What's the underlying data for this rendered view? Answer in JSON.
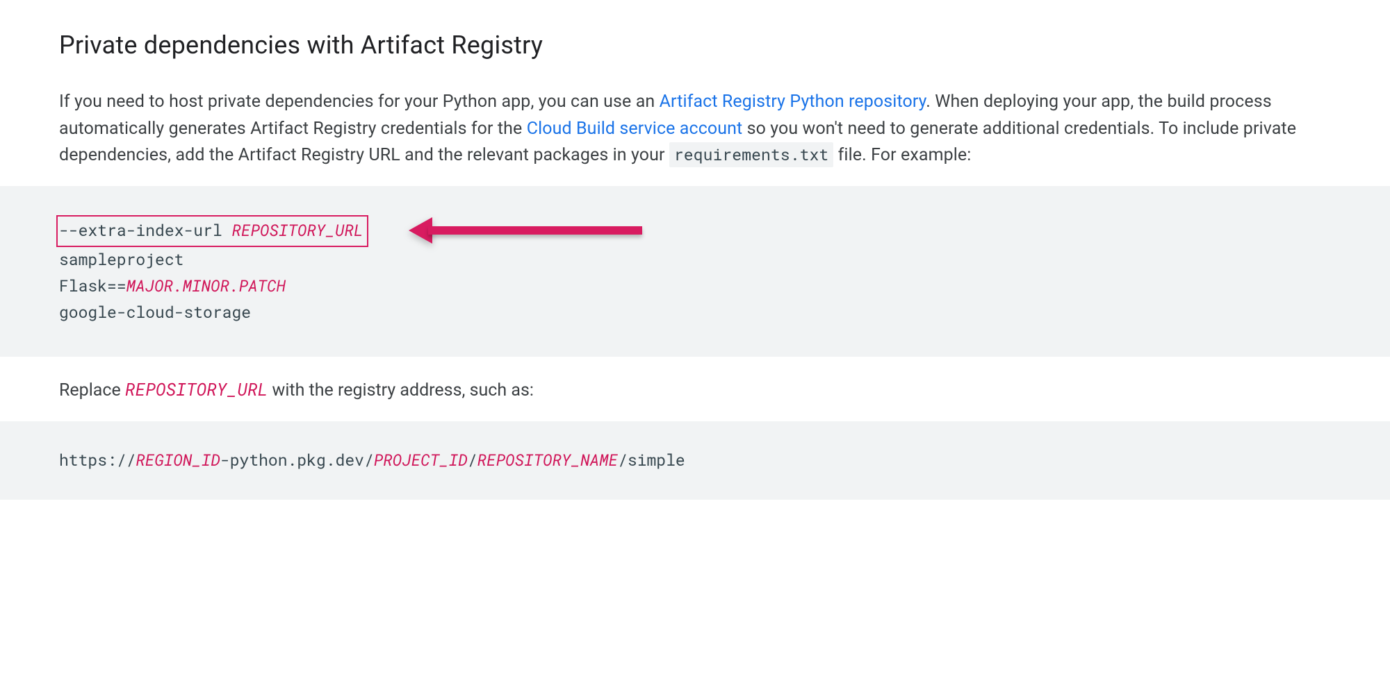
{
  "heading": "Private dependencies with Artifact Registry",
  "intro": {
    "part1": "If you need to host private dependencies for your Python app, you can use an ",
    "link1": "Artifact Registry Python repository",
    "part2": ". When deploying your app, the build process automatically generates Artifact Registry credentials for the ",
    "link2": "Cloud Build service account",
    "part3": " so you won't need to generate additional credentials. To include private dependencies, add the Artifact Registry URL and the relevant packages in your ",
    "code_file": "requirements.txt",
    "part4": " file. For example:"
  },
  "code1": {
    "l1_prefix": "--extra-index-url ",
    "l1_var": "REPOSITORY_URL",
    "l2": "sampleproject",
    "l3_prefix": "Flask==",
    "l3_var1": "MAJOR",
    "l3_dot1": ".",
    "l3_var2": "MINOR",
    "l3_dot2": ".",
    "l3_var3": "PATCH",
    "l4": "google-cloud-storage"
  },
  "replace": {
    "t1": "Replace ",
    "var": "REPOSITORY_URL",
    "t2": " with the registry address, such as:"
  },
  "code2": {
    "p1": "https://",
    "v1": "REGION_ID",
    "p2": "-python.pkg.dev/",
    "v2": "PROJECT_ID",
    "p3": "/",
    "v3": "REPOSITORY_NAME",
    "p4": "/simple"
  }
}
